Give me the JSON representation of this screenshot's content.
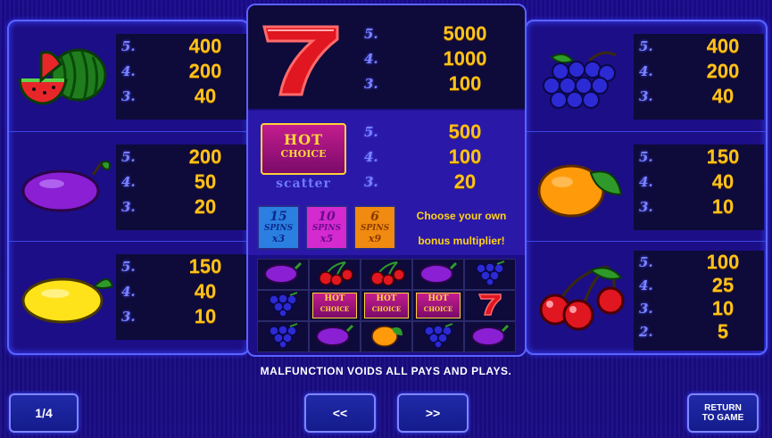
{
  "left_column": [
    {
      "symbol": "watermelon-icon",
      "pays": [
        {
          "count": "5.",
          "value": "400"
        },
        {
          "count": "4.",
          "value": "200"
        },
        {
          "count": "3.",
          "value": "40"
        }
      ]
    },
    {
      "symbol": "plum-icon",
      "pays": [
        {
          "count": "5.",
          "value": "200"
        },
        {
          "count": "4.",
          "value": "50"
        },
        {
          "count": "3.",
          "value": "20"
        }
      ]
    },
    {
      "symbol": "lemon-icon",
      "pays": [
        {
          "count": "5.",
          "value": "150"
        },
        {
          "count": "4.",
          "value": "40"
        },
        {
          "count": "3.",
          "value": "10"
        }
      ]
    }
  ],
  "right_column": [
    {
      "symbol": "grapes-icon",
      "pays": [
        {
          "count": "5.",
          "value": "400"
        },
        {
          "count": "4.",
          "value": "200"
        },
        {
          "count": "3.",
          "value": "40"
        }
      ]
    },
    {
      "symbol": "orange-icon",
      "pays": [
        {
          "count": "5.",
          "value": "150"
        },
        {
          "count": "4.",
          "value": "40"
        },
        {
          "count": "3.",
          "value": "10"
        }
      ]
    },
    {
      "symbol": "cherries-icon",
      "pays": [
        {
          "count": "5.",
          "value": "100"
        },
        {
          "count": "4.",
          "value": "25"
        },
        {
          "count": "3.",
          "value": "10"
        },
        {
          "count": "2.",
          "value": "5"
        }
      ]
    }
  ],
  "center": {
    "seven": {
      "symbol": "seven-icon",
      "pays": [
        {
          "count": "5.",
          "value": "5000"
        },
        {
          "count": "4.",
          "value": "1000"
        },
        {
          "count": "3.",
          "value": "100"
        }
      ]
    },
    "scatter": {
      "logo_line1": "HOT",
      "logo_line2": "CHOICE",
      "label": "scatter",
      "pays": [
        {
          "count": "5.",
          "value": "500"
        },
        {
          "count": "4.",
          "value": "100"
        },
        {
          "count": "3.",
          "value": "20"
        }
      ]
    },
    "bonus_options": [
      {
        "spins": "15",
        "spins_label": "SPINS",
        "multiplier": "x3",
        "color": "#2a7fe0"
      },
      {
        "spins": "10",
        "spins_label": "SPINS",
        "multiplier": "x5",
        "color": "#d42ad0"
      },
      {
        "spins": "6",
        "spins_label": "SPINS",
        "multiplier": "x9",
        "color": "#f08a10"
      }
    ],
    "bonus_text_line1": "Choose your own",
    "bonus_text_line2": "bonus multiplier!",
    "example_grid": [
      [
        "plum-icon",
        "cherries-icon",
        "cherries-icon",
        "plum-icon",
        "grapes-icon"
      ],
      [
        "grapes-icon",
        "hot-choice-icon",
        "hot-choice-icon",
        "hot-choice-icon",
        "seven-icon"
      ],
      [
        "grapes-icon",
        "plum-icon",
        "orange-icon",
        "grapes-icon",
        "plum-icon"
      ]
    ],
    "mini_logo_line1": "HOT",
    "mini_logo_line2": "CHOICE"
  },
  "notice": "MALFUNCTION VOIDS ALL PAYS AND PLAYS.",
  "buttons": {
    "page": "1/4",
    "prev": "<<",
    "next": ">>",
    "return_line1": "RETURN",
    "return_line2": "TO GAME"
  },
  "colors": {
    "accent_border": "#5a63ff",
    "pay_value": "#ffc21a",
    "count_label": "#7b83ff",
    "background": "#1a0a8c"
  }
}
